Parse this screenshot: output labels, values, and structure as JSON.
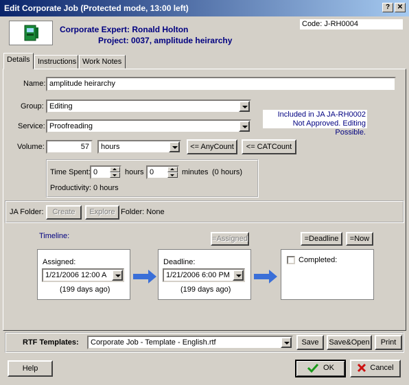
{
  "window": {
    "title": "Edit Corporate Job (Protected mode, 13:00 left)",
    "help_btn": "?",
    "close_btn": "✕"
  },
  "header": {
    "expert_label": "Corporate Expert:",
    "expert_name": "Ronald Holton",
    "project_label": "Project:",
    "project_value": "0037, amplitude heirarchy",
    "code": "Code: J-RH0004"
  },
  "tabs": [
    {
      "label": "Details"
    },
    {
      "label": "Instructions"
    },
    {
      "label": "Work Notes"
    }
  ],
  "form": {
    "name_label": "Name:",
    "name_value": "amplitude heirarchy",
    "group_label": "Group:",
    "group_value": "Editing",
    "service_label": "Service:",
    "service_value": "Proofreading",
    "ja_info_line1": "Included in JA JA-RH0002",
    "ja_info_line2": "Not Approved. Editing Possible.",
    "volume_label": "Volume:",
    "volume_value": "57",
    "volume_unit": "hours",
    "anycount_btn": "<= AnyCount",
    "catcount_btn": "<= CATCount",
    "time_spent_label": "Time Spent:",
    "time_hours_value": "0",
    "hours_label": "hours",
    "time_minutes_value": "0",
    "minutes_label": "minutes",
    "time_total": "(0 hours)",
    "productivity": "Productivity: 0 hours",
    "ja_folder_label": "JA Folder:",
    "create_btn": "Create",
    "explore_btn": "Explore",
    "folder_value": "Folder: None"
  },
  "timeline": {
    "label": "Timeline:",
    "assigned_btn": "=Assigned",
    "deadline_btn": "=Deadline",
    "now_btn": "=Now",
    "assigned_label": "Assigned:",
    "assigned_value": "1/21/2006 12:00 A",
    "assigned_ago": "(199 days ago)",
    "deadline_label": "Deadline:",
    "deadline_value": "1/21/2006 6:00 PM",
    "deadline_ago": "(199 days ago)",
    "completed_label": "Completed:"
  },
  "rtf": {
    "label": "RTF Templates:",
    "template_value": "Corporate Job - Template - English.rtf",
    "save_btn": "Save",
    "saveopen_btn": "Save&Open",
    "print_btn": "Print"
  },
  "footer": {
    "help_btn": "Help",
    "ok_btn": "OK",
    "cancel_btn": "Cancel"
  },
  "colors": {
    "title_start": "#0a246a",
    "title_end": "#a6caf0",
    "header_text": "#000080",
    "arrow": "#3a6fd8",
    "ok_check": "#1a9a1a",
    "cancel_x": "#cc1111"
  }
}
